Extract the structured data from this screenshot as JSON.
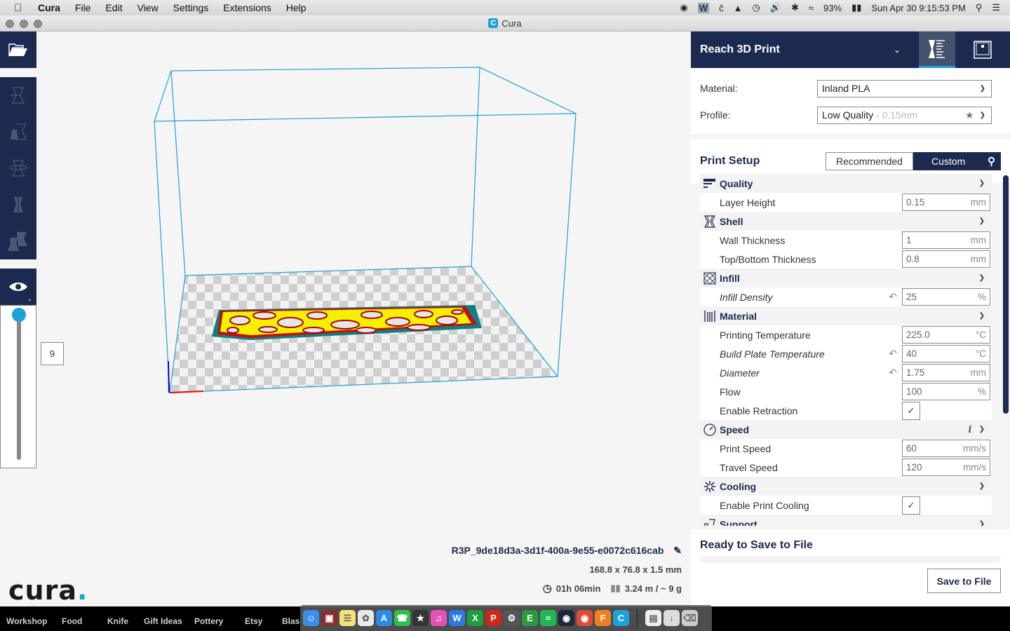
{
  "menubar": {
    "app_name": "Cura",
    "items": [
      "File",
      "Edit",
      "View",
      "Settings",
      "Extensions",
      "Help"
    ],
    "battery": "93%",
    "datetime": "Sun Apr 30  9:15:53 PM"
  },
  "window": {
    "title": "Cura"
  },
  "toolbar": {
    "open_icon": "folder-open-icon",
    "tools": [
      "translate-tool-icon",
      "scale-tool-icon",
      "rotate-tool-icon",
      "mirror-tool-icon",
      "per-model-settings-icon"
    ],
    "view_icon": "eye-icon"
  },
  "layer_view": {
    "current_layer": "9",
    "slider_position_fraction": 1.0
  },
  "job": {
    "name": "R3P_9de18d3a-3d1f-400a-9e55-e0072c616cab",
    "dimensions": "168.8 x 76.8 x 1.5 mm",
    "print_time": "01h 06min",
    "material_usage": "3.24 m / ~ 9 g"
  },
  "logo": {
    "text": "cura",
    "dot": "."
  },
  "sidebar": {
    "printer_name": "Reach 3D Print",
    "material_label": "Material:",
    "material_value": "Inland PLA",
    "profile_label": "Profile:",
    "profile_value": "Low Quality",
    "profile_suffix": " - 0.15mm",
    "print_setup_title": "Print Setup",
    "mode_recommended": "Recommended",
    "mode_custom": "Custom",
    "categories": [
      {
        "name": "Quality",
        "settings": [
          {
            "label": "Layer Height",
            "value": "0.15",
            "unit": "mm",
            "italic": false
          }
        ]
      },
      {
        "name": "Shell",
        "settings": [
          {
            "label": "Wall Thickness",
            "value": "1",
            "unit": "mm",
            "italic": false
          },
          {
            "label": "Top/Bottom Thickness",
            "value": "0.8",
            "unit": "mm",
            "italic": false
          }
        ]
      },
      {
        "name": "Infill",
        "settings": [
          {
            "label": "Infill Density",
            "value": "25",
            "unit": "%",
            "italic": true
          }
        ]
      },
      {
        "name": "Material",
        "settings": [
          {
            "label": "Printing Temperature",
            "value": "225.0",
            "unit": "°C",
            "italic": false
          },
          {
            "label": "Build Plate Temperature",
            "value": "40",
            "unit": "°C",
            "italic": true
          },
          {
            "label": "Diameter",
            "value": "1.75",
            "unit": "mm",
            "italic": true
          },
          {
            "label": "Flow",
            "value": "100",
            "unit": "%",
            "italic": false
          },
          {
            "label": "Enable Retraction",
            "checked": true
          }
        ]
      },
      {
        "name": "Speed",
        "settings": [
          {
            "label": "Print Speed",
            "value": "60",
            "unit": "mm/s",
            "italic": false
          },
          {
            "label": "Travel Speed",
            "value": "120",
            "unit": "mm/s",
            "italic": false
          }
        ]
      },
      {
        "name": "Cooling",
        "settings": [
          {
            "label": "Enable Print Cooling",
            "checked": true
          }
        ]
      },
      {
        "name": "Support",
        "settings": []
      }
    ],
    "save_title": "Ready to Save to File",
    "save_progress": 0,
    "save_button": "Save to File"
  },
  "bookmarks": [
    "Workshop",
    "Food",
    "Knife",
    "Gift Ideas",
    "Pottery",
    "Etsy",
    "Blas"
  ],
  "dock": [
    "Finder",
    "Photo Booth",
    "Notes",
    "Photos",
    "App Store",
    "FaceTime",
    "iMovie",
    "iTunes",
    "Word",
    "Excel",
    "PowerPoint",
    "System Preferences",
    "Evernote",
    "Spotify",
    "Steam",
    "Chrome",
    "Fusion 360",
    "Cura",
    "Document",
    "Downloads",
    "Trash"
  ],
  "colors": {
    "navy": "#1b2a4e",
    "accent": "#1da1db",
    "build_volume": "#1da1db"
  }
}
